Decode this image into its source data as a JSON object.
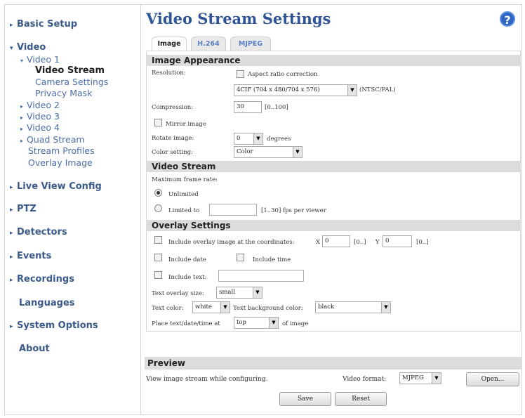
{
  "sidebar": {
    "basic_setup": "Basic Setup",
    "video": "Video",
    "video1": "Video 1",
    "video_stream": "Video Stream",
    "camera_settings": "Camera Settings",
    "privacy_mask": "Privacy Mask",
    "video2": "Video 2",
    "video3": "Video 3",
    "video4": "Video 4",
    "quad_stream": "Quad Stream",
    "stream_profiles": "Stream Profiles",
    "overlay_image": "Overlay Image",
    "live_view_config": "Live View Config",
    "ptz": "PTZ",
    "detectors": "Detectors",
    "events": "Events",
    "recordings": "Recordings",
    "languages": "Languages",
    "system_options": "System Options",
    "about": "About"
  },
  "header": {
    "title": "Video Stream Settings",
    "help": "?"
  },
  "tabs": [
    "Image",
    "H.264",
    "MJPEG"
  ],
  "image_appearance": {
    "heading": "Image Appearance",
    "resolution_label": "Resolution:",
    "aspect_label": "Aspect ratio correction",
    "resolution_value": "4CIF (704 x 480/704 x 576)",
    "resolution_suffix": "(NTSC/PAL)",
    "compression_label": "Compression:",
    "compression_value": "30",
    "compression_range": "[0..100]",
    "mirror_label": "Mirror image",
    "rotate_label": "Rotate image:",
    "rotate_value": "0",
    "rotate_suffix": "degrees",
    "color_label": "Color setting:",
    "color_value": "Color"
  },
  "video_stream": {
    "heading": "Video Stream",
    "max_frame_label": "Maximum frame rate:",
    "unlimited_label": "Unlimited",
    "limited_label": "Limited to",
    "limited_value": "",
    "limited_suffix": "[1..30] fps per viewer"
  },
  "overlay": {
    "heading": "Overlay Settings",
    "include_overlay_label": "Include overlay image at the coordinates:",
    "x_label": "X",
    "x_value": "0",
    "x_range": "[0..]",
    "y_label": "Y",
    "y_value": "0",
    "y_range": "[0..]",
    "include_date": "Include date",
    "include_time": "Include time",
    "include_text": "Include text:",
    "include_text_value": "",
    "text_size_label": "Text overlay size:",
    "text_size_value": "small",
    "text_color_label": "Text color:",
    "text_color_value": "white",
    "text_bg_label": "Text background color:",
    "text_bg_value": "black",
    "place_label": "Place text/date/time at",
    "place_value": "top",
    "place_suffix": "of image"
  },
  "preview": {
    "heading": "Preview",
    "view_label": "View image stream while configuring.",
    "format_label": "Video format:",
    "format_value": "MJPEG",
    "open_button": "Open..."
  },
  "actions": {
    "save": "Save",
    "reset": "Reset"
  }
}
